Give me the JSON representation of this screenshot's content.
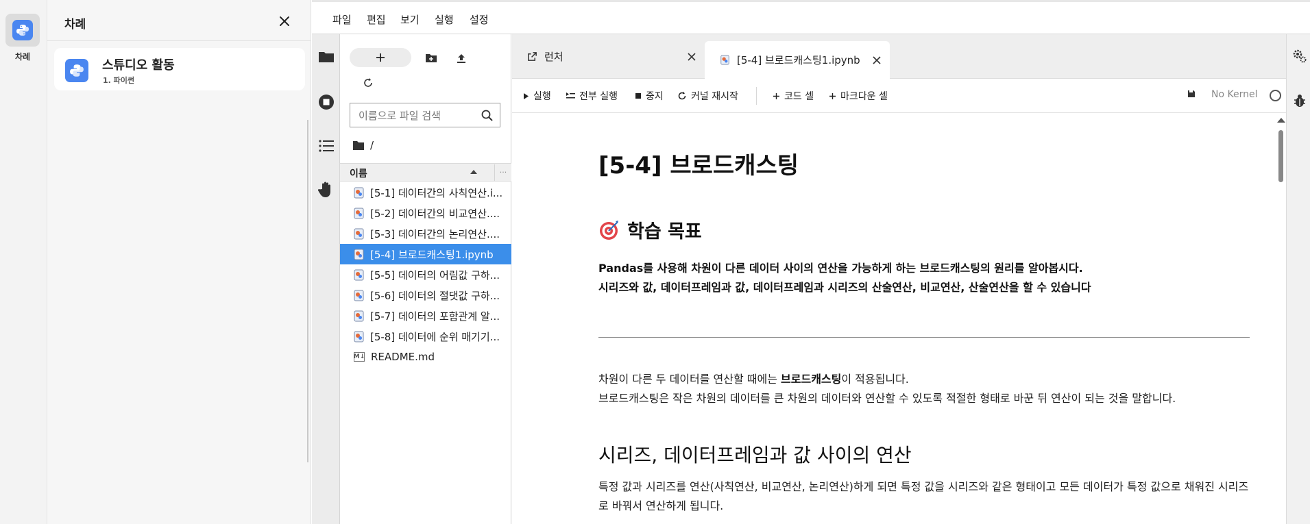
{
  "rail": {
    "label": "차례"
  },
  "toc": {
    "title": "차례",
    "card": {
      "title": "스튜디오 활동",
      "subtitle": "1. 파이썬"
    }
  },
  "menu": [
    "파일",
    "편집",
    "보기",
    "실행",
    "설정"
  ],
  "filebrowser": {
    "search_placeholder": "이름으로 파일 검색",
    "breadcrumb": "/",
    "column_name": "이름",
    "column_more": "...",
    "files": [
      {
        "name": "[5-1] 데이터간의 사칙연산.i...",
        "type": "notebook"
      },
      {
        "name": "[5-2] 데이터간의 비교연산....",
        "type": "notebook"
      },
      {
        "name": "[5-3] 데이터간의 논리연산....",
        "type": "notebook"
      },
      {
        "name": "[5-4] 브로드캐스팅1.ipynb",
        "type": "notebook",
        "selected": true
      },
      {
        "name": "[5-5] 데이터의 어림값 구하...",
        "type": "notebook"
      },
      {
        "name": "[5-6] 데이터의 절댓값 구하...",
        "type": "notebook"
      },
      {
        "name": "[5-7] 데이터의 포함관계 알...",
        "type": "notebook"
      },
      {
        "name": "[5-8] 데이터에 순위 매기기...",
        "type": "notebook"
      },
      {
        "name": "README.md",
        "type": "markdown"
      }
    ]
  },
  "tabs": [
    {
      "label": "런처",
      "icon": "launcher-icon"
    },
    {
      "label": "[5-4] 브로드캐스팅1.ipynb",
      "icon": "notebook-icon",
      "active": true
    }
  ],
  "toolbar": {
    "run": "실행",
    "run_all": "전부 실행",
    "stop": "중지",
    "restart": "커널 재시작",
    "add_code": "코드 셀",
    "add_markdown": "마크다운 셀",
    "kernel": "No Kernel"
  },
  "notebook": {
    "title": "[5-4] 브로드캐스팅",
    "goal_heading": "학습 목표",
    "goal_line1": "Pandas를 사용해 차원이 다른 데이터 사이의 연산을 가능하게 하는 브로드캐스팅의 원리를 알아봅시다.",
    "goal_line2": "시리즈와 값, 데이터프레임과 값, 데이터프레임과 시리즈의 산술연산, 비교연산, 산술연산을 할 수 있습니다",
    "intro_pre": "차원이 다른 두 데이터를 연산할 때에는 ",
    "intro_bold": "브로드캐스팅",
    "intro_post": "이 적용됩니다.",
    "intro_line2": "브로드캐스팅은 작은 차원의 데이터를 큰 차원의 데이터와 연산할 수 있도록 적절한 형태로 바꾼 뒤 연산이 되는 것을 말합니다.",
    "section_heading": "시리즈, 데이터프레임과 값 사이의 연산",
    "section_text": "특정 값과 시리즈를 연산(사칙연산, 비교연산, 논리연산)하게 되면 특정 값을 시리즈와 같은 형태이고 모든 데이터가 특정 값으로 채워진 시리즈로 바꿔서 연산하게 됩니다."
  },
  "colors": {
    "accent": "#3b8eea",
    "python_logo": "#4a86f0"
  }
}
